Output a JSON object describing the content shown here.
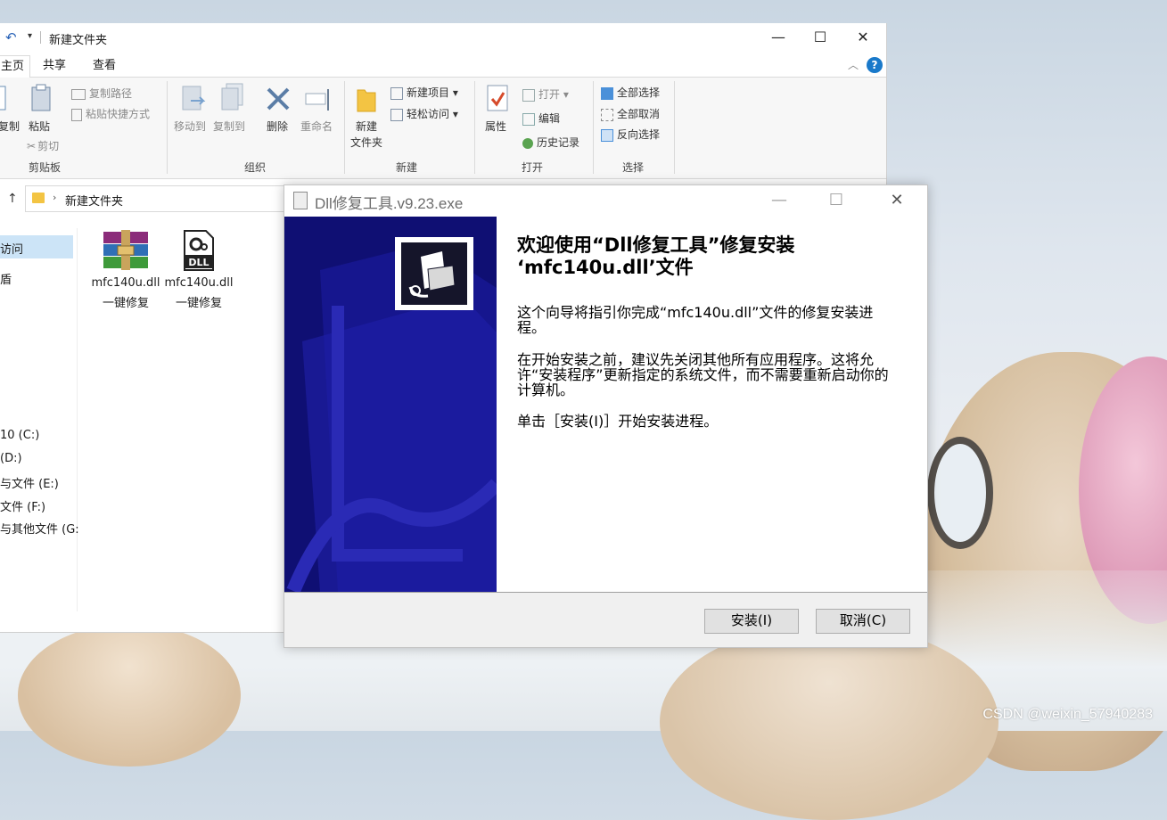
{
  "explorer": {
    "title": "新建文件夹",
    "tabs": [
      "主页",
      "共享",
      "查看"
    ],
    "ribbon": {
      "clipboard": {
        "copy_label": "复制",
        "paste_label": "粘贴",
        "copy_path": "复制路径",
        "paste_shortcut": "粘贴快捷方式",
        "cut": "剪切",
        "group": "剪贴板"
      },
      "organize": {
        "move_to": "移动到",
        "copy_to": "复制到",
        "delete": "删除",
        "rename": "重命名",
        "group": "组织"
      },
      "new": {
        "new_folder_line1": "新建",
        "new_folder_line2": "文件夹",
        "new_item": "新建项目 ▾",
        "easy_access": "轻松访问 ▾",
        "group": "新建"
      },
      "open": {
        "properties": "属性",
        "open": "打开 ▾",
        "edit": "编辑",
        "history": "历史记录",
        "group": "打开"
      },
      "select": {
        "select_all": "全部选择",
        "select_none": "全部取消",
        "invert": "反向选择",
        "group": "选择"
      }
    },
    "address": {
      "path": "新建文件夹"
    },
    "nav": [
      "访问",
      "盾",
      "10 (C:)",
      "(D:)",
      "与文件 (E:)",
      "文件 (F:)",
      "与其他文件 (G:"
    ],
    "files": [
      {
        "name": "mfc140u.dll",
        "sub": "一键修复",
        "icon": "winrar-archive-icon"
      },
      {
        "name": "mfc140u.dll",
        "sub": "一键修复",
        "icon": "dll-file-icon"
      }
    ]
  },
  "dialog": {
    "title": "Dll修复工具.v9.23.exe",
    "heading_line1": "欢迎使用“Dll修复工具”修复安装",
    "heading_line2": "‘mfc140u.dll’文件",
    "p1": "这个向导将指引你完成“mfc140u.dll”文件的修复安装进程。",
    "p2": "在开始安装之前，建议先关闭其他所有应用程序。这将允许“安装程序”更新指定的系统文件，而不需要重新启动你的计算机。",
    "p3": "单击［安装(I)］开始安装进程。",
    "install_button": "安装(I)",
    "cancel_button": "取消(C)",
    "accent_color": "#0f0f73"
  },
  "watermark": "CSDN @weixin_57940283"
}
